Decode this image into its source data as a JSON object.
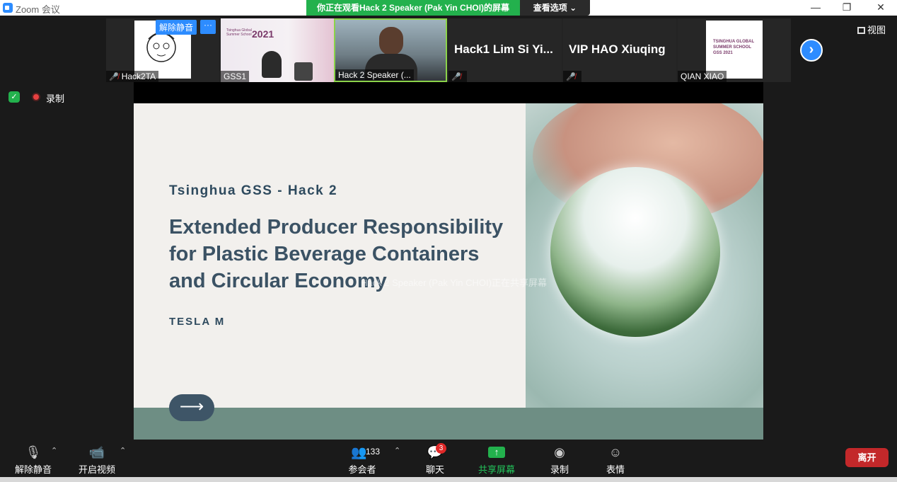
{
  "window": {
    "title": "Zoom 会议"
  },
  "banner": {
    "viewing": "你正在观看Hack 2 Speaker (Pak Yin CHOI)的屏幕",
    "view_options": "查看选项 ⌄"
  },
  "participants": [
    {
      "name": "Hack2TA",
      "muted": true
    },
    {
      "name": "GSS1",
      "muted": false
    },
    {
      "name": "Hack 2 Speaker (...",
      "muted": true
    },
    {
      "name": "Hack1 Lim Si Yi...",
      "muted": true
    },
    {
      "name": "VIP HAO Xiuqing",
      "muted": true
    },
    {
      "name": "QIAN XIAO",
      "muted": false
    }
  ],
  "tile_controls": {
    "unmute_label": "解除静音",
    "more_label": "···"
  },
  "gss_logo": {
    "line1": "Tsinghua Global",
    "line2": "Summer School",
    "year": "2021"
  },
  "qian_logo": {
    "line1": "TSINGHUA GLOBAL",
    "line2": "SUMMER SCHOOL",
    "line3": "GSS 2021"
  },
  "gallery": {
    "label": "视图"
  },
  "recording": {
    "label": "录制"
  },
  "slide": {
    "subtitle": "Tsinghua GSS - Hack 2",
    "headline": "Extended Producer Responsibility for Plastic Beverage Containers and Circular Economy",
    "author": "TESLA M",
    "arrow": "⟶"
  },
  "overlay": {
    "text": "Hack 2 Speaker (Pak Yin CHOI)正在共享屏幕"
  },
  "toolbar": {
    "unmute": "解除静音",
    "video": "开启视频",
    "participants": "参会者",
    "participants_count": "133",
    "chat": "聊天",
    "chat_badge": "3",
    "share": "共享屏幕",
    "record": "录制",
    "reactions": "表情",
    "leave": "离开"
  },
  "colors": {
    "accent": "#2d8cff",
    "share_green": "#23b14d",
    "leave_red": "#c3282a",
    "slide_title": "#3b5264"
  }
}
